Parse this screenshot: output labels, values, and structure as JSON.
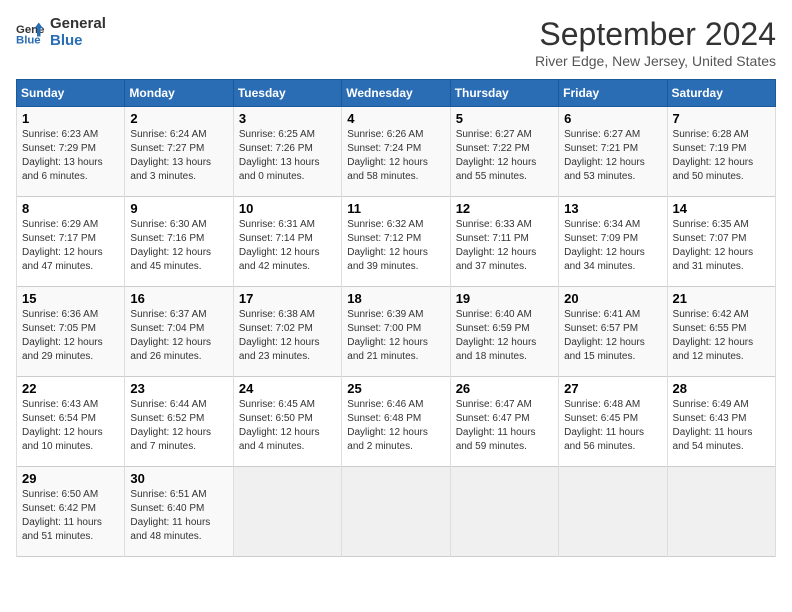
{
  "header": {
    "logo_line1": "General",
    "logo_line2": "Blue",
    "title": "September 2024",
    "subtitle": "River Edge, New Jersey, United States"
  },
  "weekdays": [
    "Sunday",
    "Monday",
    "Tuesday",
    "Wednesday",
    "Thursday",
    "Friday",
    "Saturday"
  ],
  "weeks": [
    [
      {
        "day": "1",
        "sunrise": "6:23 AM",
        "sunset": "7:29 PM",
        "daylight": "13 hours and 6 minutes."
      },
      {
        "day": "2",
        "sunrise": "6:24 AM",
        "sunset": "7:27 PM",
        "daylight": "13 hours and 3 minutes."
      },
      {
        "day": "3",
        "sunrise": "6:25 AM",
        "sunset": "7:26 PM",
        "daylight": "13 hours and 0 minutes."
      },
      {
        "day": "4",
        "sunrise": "6:26 AM",
        "sunset": "7:24 PM",
        "daylight": "12 hours and 58 minutes."
      },
      {
        "day": "5",
        "sunrise": "6:27 AM",
        "sunset": "7:22 PM",
        "daylight": "12 hours and 55 minutes."
      },
      {
        "day": "6",
        "sunrise": "6:27 AM",
        "sunset": "7:21 PM",
        "daylight": "12 hours and 53 minutes."
      },
      {
        "day": "7",
        "sunrise": "6:28 AM",
        "sunset": "7:19 PM",
        "daylight": "12 hours and 50 minutes."
      }
    ],
    [
      {
        "day": "8",
        "sunrise": "6:29 AM",
        "sunset": "7:17 PM",
        "daylight": "12 hours and 47 minutes."
      },
      {
        "day": "9",
        "sunrise": "6:30 AM",
        "sunset": "7:16 PM",
        "daylight": "12 hours and 45 minutes."
      },
      {
        "day": "10",
        "sunrise": "6:31 AM",
        "sunset": "7:14 PM",
        "daylight": "12 hours and 42 minutes."
      },
      {
        "day": "11",
        "sunrise": "6:32 AM",
        "sunset": "7:12 PM",
        "daylight": "12 hours and 39 minutes."
      },
      {
        "day": "12",
        "sunrise": "6:33 AM",
        "sunset": "7:11 PM",
        "daylight": "12 hours and 37 minutes."
      },
      {
        "day": "13",
        "sunrise": "6:34 AM",
        "sunset": "7:09 PM",
        "daylight": "12 hours and 34 minutes."
      },
      {
        "day": "14",
        "sunrise": "6:35 AM",
        "sunset": "7:07 PM",
        "daylight": "12 hours and 31 minutes."
      }
    ],
    [
      {
        "day": "15",
        "sunrise": "6:36 AM",
        "sunset": "7:05 PM",
        "daylight": "12 hours and 29 minutes."
      },
      {
        "day": "16",
        "sunrise": "6:37 AM",
        "sunset": "7:04 PM",
        "daylight": "12 hours and 26 minutes."
      },
      {
        "day": "17",
        "sunrise": "6:38 AM",
        "sunset": "7:02 PM",
        "daylight": "12 hours and 23 minutes."
      },
      {
        "day": "18",
        "sunrise": "6:39 AM",
        "sunset": "7:00 PM",
        "daylight": "12 hours and 21 minutes."
      },
      {
        "day": "19",
        "sunrise": "6:40 AM",
        "sunset": "6:59 PM",
        "daylight": "12 hours and 18 minutes."
      },
      {
        "day": "20",
        "sunrise": "6:41 AM",
        "sunset": "6:57 PM",
        "daylight": "12 hours and 15 minutes."
      },
      {
        "day": "21",
        "sunrise": "6:42 AM",
        "sunset": "6:55 PM",
        "daylight": "12 hours and 12 minutes."
      }
    ],
    [
      {
        "day": "22",
        "sunrise": "6:43 AM",
        "sunset": "6:54 PM",
        "daylight": "12 hours and 10 minutes."
      },
      {
        "day": "23",
        "sunrise": "6:44 AM",
        "sunset": "6:52 PM",
        "daylight": "12 hours and 7 minutes."
      },
      {
        "day": "24",
        "sunrise": "6:45 AM",
        "sunset": "6:50 PM",
        "daylight": "12 hours and 4 minutes."
      },
      {
        "day": "25",
        "sunrise": "6:46 AM",
        "sunset": "6:48 PM",
        "daylight": "12 hours and 2 minutes."
      },
      {
        "day": "26",
        "sunrise": "6:47 AM",
        "sunset": "6:47 PM",
        "daylight": "11 hours and 59 minutes."
      },
      {
        "day": "27",
        "sunrise": "6:48 AM",
        "sunset": "6:45 PM",
        "daylight": "11 hours and 56 minutes."
      },
      {
        "day": "28",
        "sunrise": "6:49 AM",
        "sunset": "6:43 PM",
        "daylight": "11 hours and 54 minutes."
      }
    ],
    [
      {
        "day": "29",
        "sunrise": "6:50 AM",
        "sunset": "6:42 PM",
        "daylight": "11 hours and 51 minutes."
      },
      {
        "day": "30",
        "sunrise": "6:51 AM",
        "sunset": "6:40 PM",
        "daylight": "11 hours and 48 minutes."
      },
      null,
      null,
      null,
      null,
      null
    ]
  ],
  "labels": {
    "sunrise": "Sunrise:",
    "sunset": "Sunset:",
    "daylight": "Daylight:"
  }
}
